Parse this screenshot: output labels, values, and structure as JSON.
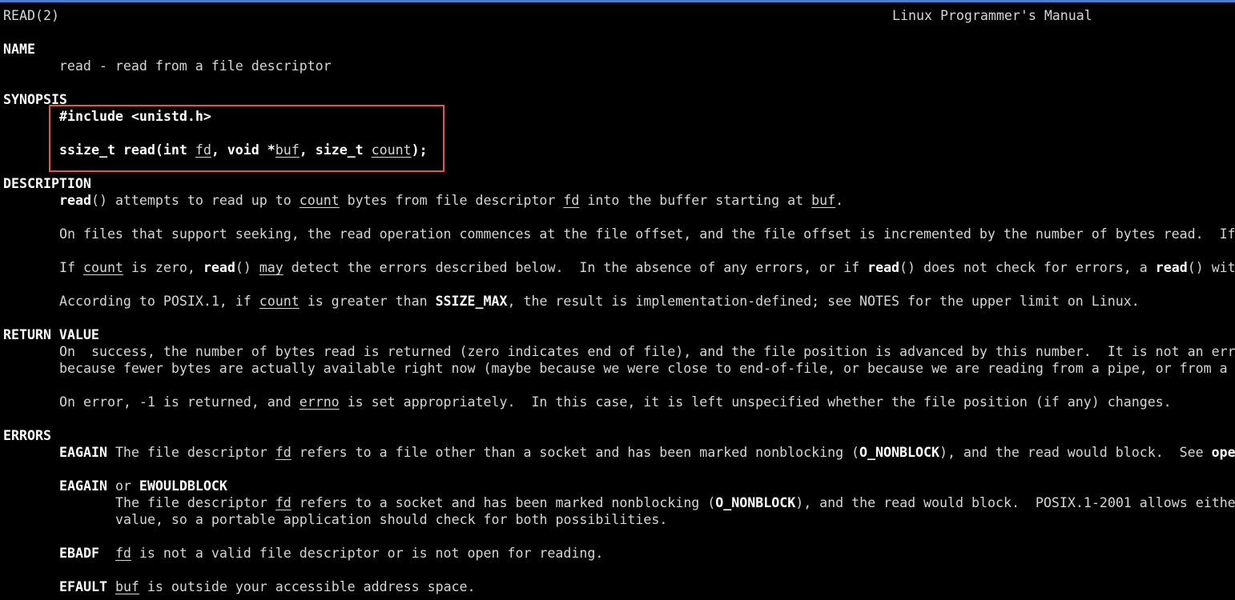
{
  "header": {
    "left": "READ(2)",
    "right": "Linux Programmer's Manual"
  },
  "sections": {
    "name": "NAME",
    "synopsis": "SYNOPSIS",
    "description": "DESCRIPTION",
    "return_value": "RETURN VALUE",
    "errors": "ERRORS"
  },
  "name_line": "       read - read from a file descriptor",
  "synopsis": {
    "include": "#include <unistd.h>",
    "proto_a": "ssize_t read(int ",
    "proto_fd": "fd",
    "proto_b": ", void *",
    "proto_buf": "buf",
    "proto_c": ", size_t ",
    "proto_count": "count",
    "proto_d": ");"
  },
  "description": {
    "l1_fn": "read",
    "l1_a": "() attempts to read up to ",
    "l1_count": "count",
    "l1_b": " bytes from file descriptor ",
    "l1_fd": "fd",
    "l1_c": " into the buffer starting at ",
    "l1_buf": "buf",
    "l1_d": ".",
    "l2": "On files that support seeking, the read operation commences at the file offset, and the file offset is incremented by the number of bytes read.  If",
    "l3_a": "If ",
    "l3_count": "count",
    "l3_b": " is zero, ",
    "l3_read1": "read",
    "l3_c": "() ",
    "l3_may": "may",
    "l3_d": " detect the errors described below.  In the absence of any errors, or if ",
    "l3_read2": "read",
    "l3_e": "() does not check for errors, a ",
    "l3_read3": "read",
    "l3_f": "() wit",
    "l4_a": "According to POSIX.1, if ",
    "l4_count": "count",
    "l4_b": " is greater than ",
    "l4_ssize": "SSIZE_MAX",
    "l4_c": ", the result is implementation-defined; see NOTES for the upper limit on Linux."
  },
  "return_value": {
    "l1": "On  success, the number of bytes read is returned (zero indicates end of file), and the file position is advanced by this number.  It is not an err",
    "l2": "because fewer bytes are actually available right now (maybe because we were close to end-of-file, or because we are reading from a pipe, or from a",
    "l3_a": "On error, -1 is returned, and ",
    "l3_errno": "errno",
    "l3_b": " is set appropriately.  In this case, it is left unspecified whether the file position (if any) changes."
  },
  "errors": {
    "e1_name": "EAGAIN",
    "e1_a": " The file descriptor ",
    "e1_fd": "fd",
    "e1_b": " refers to a file other than a socket and has been marked nonblocking (",
    "e1_flag": "O_NONBLOCK",
    "e1_c": "), and the read would block.  See ",
    "e1_ope": "ope",
    "e2_name_a": "EAGAIN",
    "e2_or": " or ",
    "e2_name_b": "EWOULDBLOCK",
    "e2_a": "The file descriptor ",
    "e2_fd": "fd",
    "e2_b": " refers to a socket and has been marked nonblocking (",
    "e2_flag": "O_NONBLOCK",
    "e2_c": "), and the read would block.  POSIX.1-2001 allows eithe",
    "e2_l2": "value, so a portable application should check for both possibilities.",
    "e3_name": "EBADF",
    "e3_sp": "  ",
    "e3_fd": "fd",
    "e3_a": " is not a valid file descriptor or is not open for reading.",
    "e4_name": "EFAULT",
    "e4_sp": " ",
    "e4_buf": "buf",
    "e4_a": " is outside your accessible address space."
  },
  "colors": {
    "background": "#000000",
    "text": "#d6d6d6",
    "bold": "#ffffff",
    "highlight_border": "#e0574f",
    "top_accent": "#4a7fd6"
  }
}
